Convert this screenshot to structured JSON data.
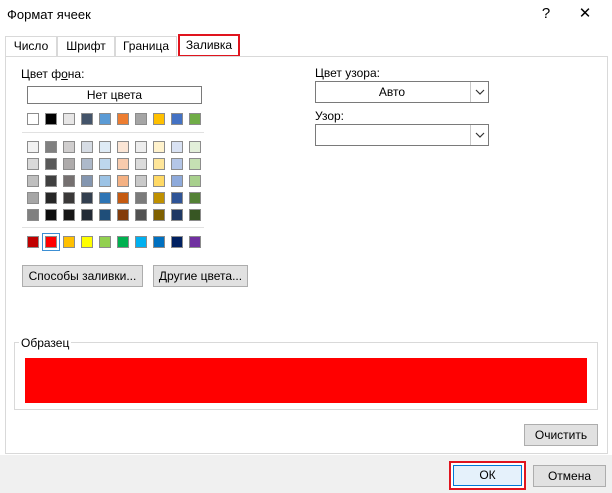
{
  "window": {
    "title": "Формат ячеек",
    "help": "?",
    "close": "✕"
  },
  "tabs": [
    {
      "label": "Число",
      "active": false
    },
    {
      "label": "Шрифт",
      "active": false
    },
    {
      "label": "Граница",
      "active": false
    },
    {
      "label": "Заливка",
      "active": true
    }
  ],
  "fill": {
    "bg_label_pre": "Цвет ф",
    "bg_label_u": "о",
    "bg_label_post": "на:",
    "no_color": "Нет цвета",
    "theme_row": [
      "#ffffff",
      "#000000",
      "#e7e6e6",
      "#44546a",
      "#5b9bd5",
      "#ed7d31",
      "#a5a5a5",
      "#ffc000",
      "#4472c4",
      "#70ad47"
    ],
    "tint_rows": [
      [
        "#f2f2f2",
        "#808080",
        "#d0cece",
        "#d6dce4",
        "#deebf6",
        "#fbe5d5",
        "#ededed",
        "#fff2cc",
        "#d9e2f3",
        "#e2efd9"
      ],
      [
        "#d9d9d9",
        "#595959",
        "#aeabab",
        "#adb9ca",
        "#bdd7ee",
        "#f8cbad",
        "#dbdbdb",
        "#fee599",
        "#b4c6e7",
        "#c5e0b3"
      ],
      [
        "#bfbfbf",
        "#404040",
        "#757070",
        "#8496b0",
        "#9cc3e5",
        "#f4b183",
        "#c9c9c9",
        "#ffd965",
        "#8eaadb",
        "#a8d08d"
      ],
      [
        "#a6a6a6",
        "#262626",
        "#3a3838",
        "#333f4f",
        "#2e75b5",
        "#c55a11",
        "#7b7b7b",
        "#bf9000",
        "#2f5496",
        "#538135"
      ],
      [
        "#808080",
        "#0d0d0d",
        "#171616",
        "#222a35",
        "#1f4e79",
        "#833c0b",
        "#525252",
        "#7f6000",
        "#1f3864",
        "#375623"
      ]
    ],
    "standard_row": [
      "#c00000",
      "#ff0000",
      "#ffc000",
      "#ffff00",
      "#92d050",
      "#00b050",
      "#00b0f0",
      "#0070c0",
      "#002060",
      "#7030a0"
    ],
    "selected_standard_index": 1,
    "fill_effects_label": "Способы заливки...",
    "more_colors_label": "Другие цвета...",
    "pattern_color_label": "Цвет узора:",
    "pattern_color_value": "Авто",
    "pattern_style_label": "Узор:",
    "pattern_style_value": "",
    "sample_label": "Образец",
    "sample_color": "#ff0000",
    "clear_label": "Очистить"
  },
  "footer": {
    "ok": "ОК",
    "cancel": "Отмена"
  }
}
